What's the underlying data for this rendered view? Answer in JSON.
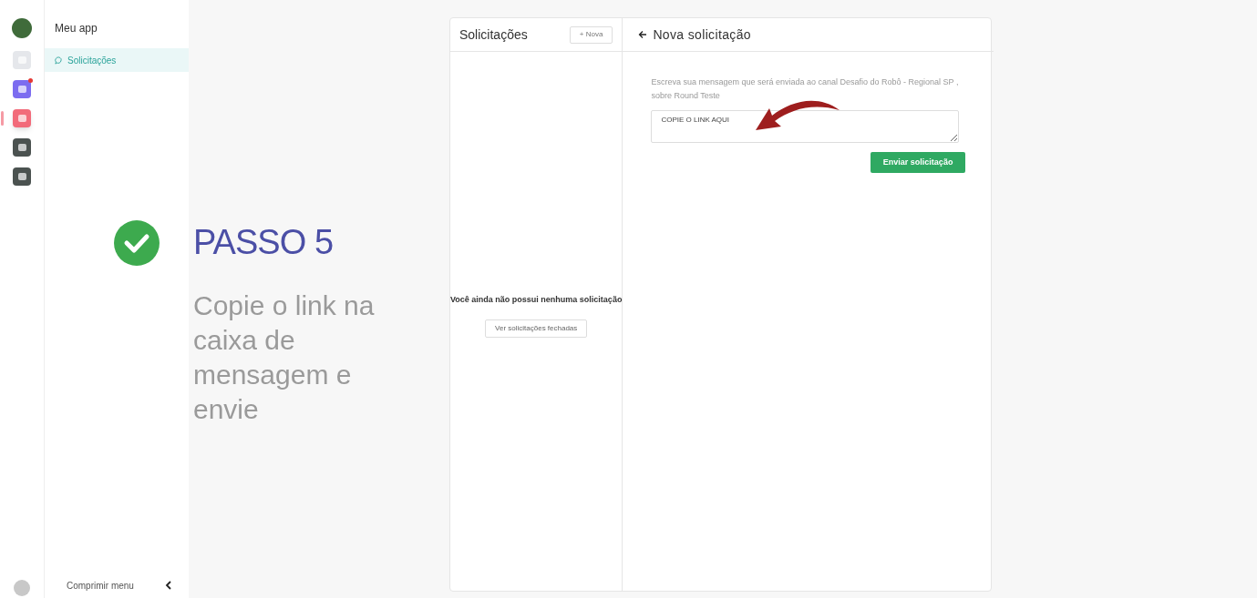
{
  "rail": {
    "items": [
      {
        "color": "#e5e7eb",
        "selected": false,
        "notification": false
      },
      {
        "color": "#7c6cf0",
        "selected": false,
        "notification": true
      },
      {
        "color": "#f26b7a",
        "selected": true,
        "notification": false
      },
      {
        "color": "#4b5250",
        "selected": false,
        "notification": false
      },
      {
        "color": "#4b5250",
        "selected": false,
        "notification": false
      }
    ]
  },
  "sidebar": {
    "title": "Meu app",
    "items": [
      {
        "label": "Solicitações",
        "selected": true
      }
    ],
    "collapse": "Comprimir menu"
  },
  "step": {
    "title": "PASSO 5",
    "text": "Copie o link na caixa de mensagem e envie"
  },
  "list_panel": {
    "title": "Solicitações",
    "new_button": "+ Nova",
    "empty": "Você ainda não possui nenhuma solicitação",
    "closed_button": "Ver solicitações fechadas"
  },
  "form": {
    "title": "Nova solicitação",
    "description": "Escreva sua mensagem que será enviada ao canal Desafio do Robô - Regional SP , sobre Round Teste",
    "message": "COPIE O LINK AQUI",
    "submit": "Enviar solicitação"
  }
}
